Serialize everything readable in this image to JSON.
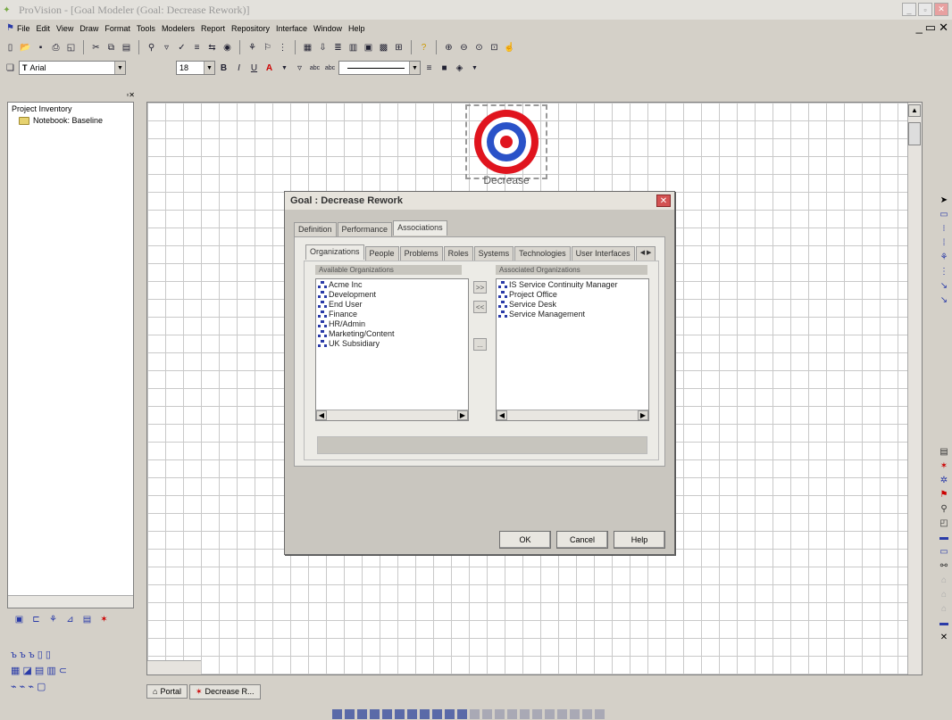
{
  "app": {
    "title": "ProVision - [Goal Modeler (Goal: Decrease Rework)]"
  },
  "menu": [
    "File",
    "Edit",
    "View",
    "Draw",
    "Format",
    "Tools",
    "Modelers",
    "Report",
    "Repository",
    "Interface",
    "Window",
    "Help"
  ],
  "font": {
    "family": "Arial",
    "size": "18"
  },
  "inventory": {
    "title": "Project Inventory",
    "item": "Notebook: Baseline"
  },
  "canvas": {
    "goal_label": "Decrease"
  },
  "dialog": {
    "title": "Goal : Decrease Rework",
    "tabs": [
      "Definition",
      "Performance",
      "Associations"
    ],
    "subtabs": [
      "Organizations",
      "People",
      "Problems",
      "Roles",
      "Systems",
      "Technologies",
      "User Interfaces"
    ],
    "available_header": "Available Organizations",
    "associated_header": "Associated Organizations",
    "available": [
      "Acme Inc",
      "Development",
      "End User",
      "Finance",
      "HR/Admin",
      "Marketing/Content",
      "UK Subsidiary"
    ],
    "associated": [
      "IS Service Continuity Manager",
      "Project Office",
      "Service Desk",
      "Service Management"
    ],
    "add_label": ">>",
    "remove_label": "<<",
    "more_label": "...",
    "ok": "OK",
    "cancel": "Cancel",
    "help": "Help"
  },
  "bottom_tabs": [
    "Portal",
    "Decrease R..."
  ],
  "colors": {
    "target_red": "#e0141e",
    "target_blue": "#2a52c8",
    "accent": "#2a3ba8"
  }
}
